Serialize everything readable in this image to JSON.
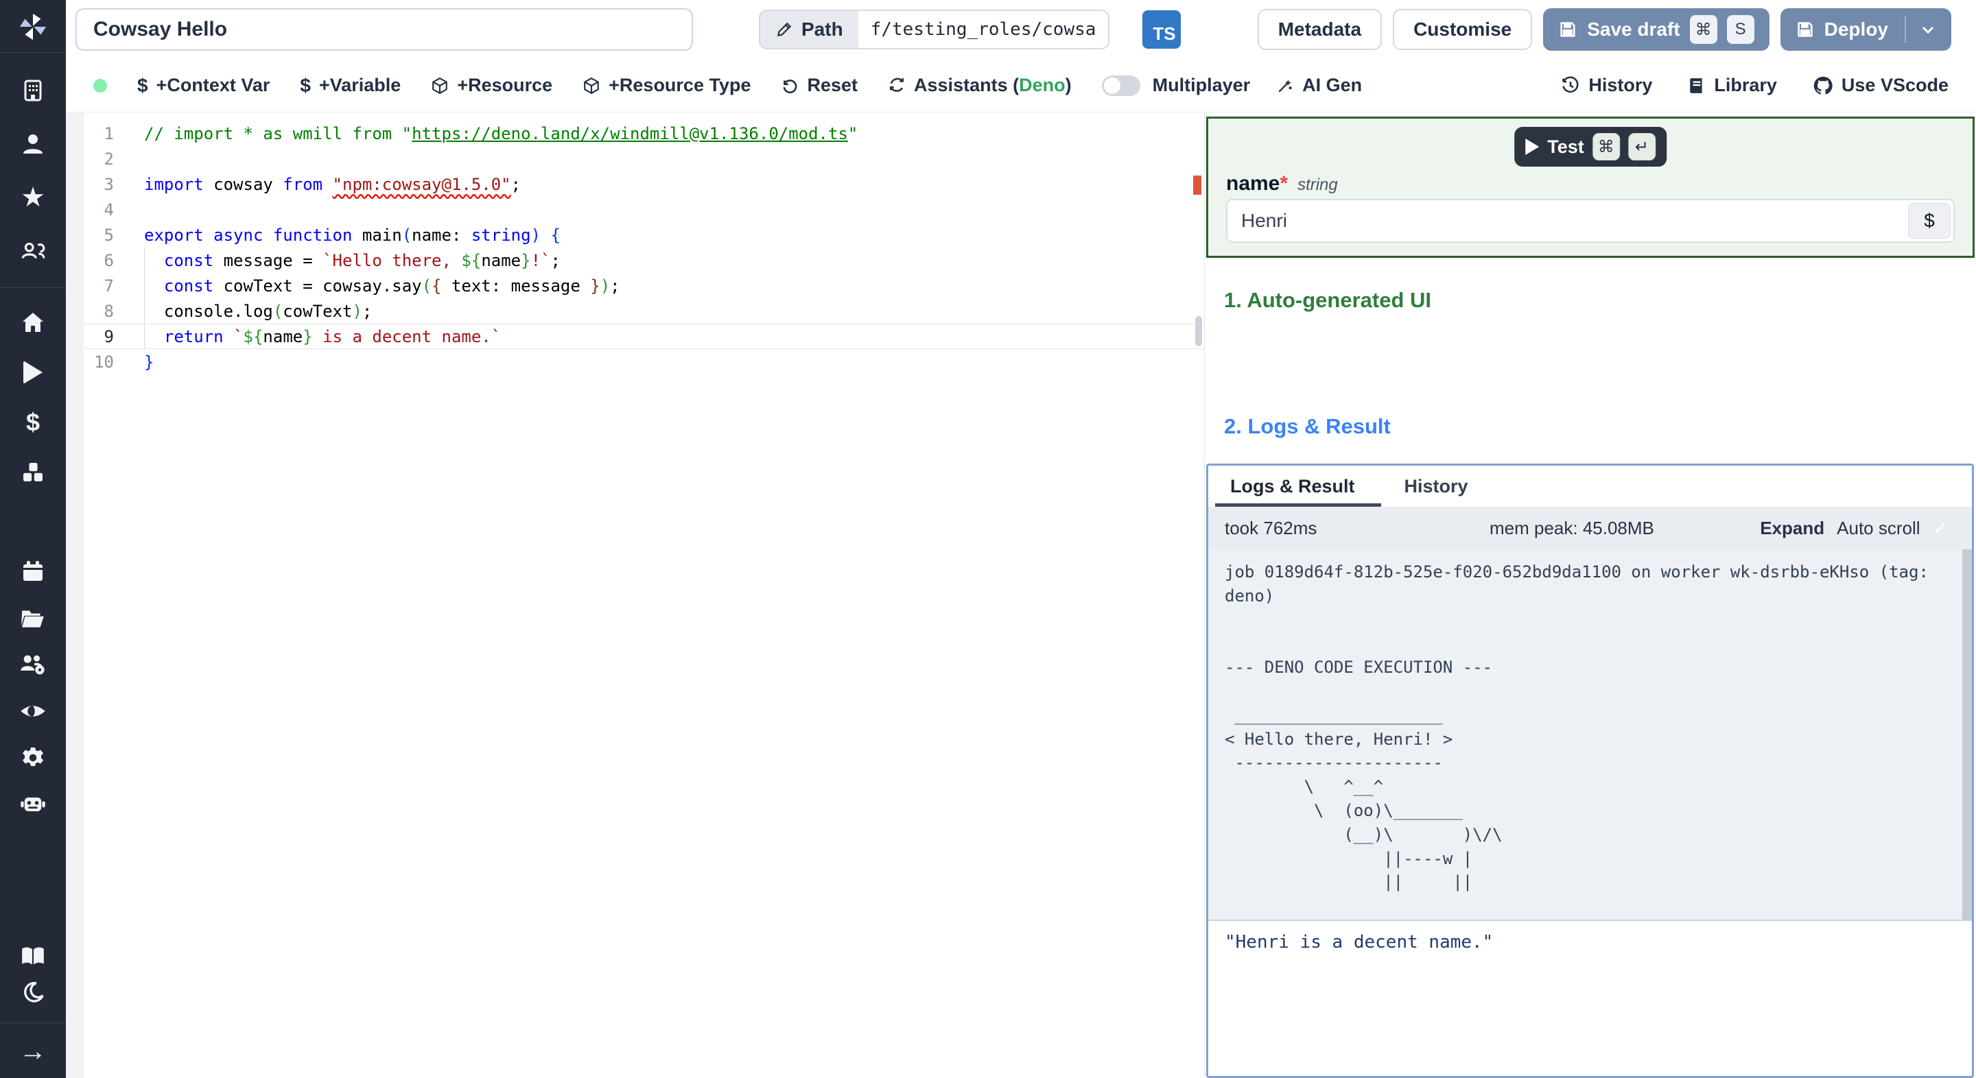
{
  "topbar": {
    "title_value": "Cowsay Hello",
    "path_label": "Path",
    "path_value": "f/testing_roles/cowsa",
    "ts_badge": "TS",
    "metadata_label": "Metadata",
    "customise_label": "Customise",
    "save_draft_label": "Save draft",
    "save_kbd1": "⌘",
    "save_kbd2": "S",
    "deploy_label": "Deploy"
  },
  "toolbar": {
    "context_var": "+Context Var",
    "variable": "+Variable",
    "resource": "+Resource",
    "resource_type": "+Resource Type",
    "reset": "Reset",
    "assistants_prefix": "Assistants (",
    "assistants_lang": "Deno",
    "assistants_suffix": ")",
    "multiplayer": "Multiplayer",
    "ai_gen": "AI Gen",
    "history": "History",
    "library": "Library",
    "use_vscode": "Use VScode",
    "dollar_icon": "$"
  },
  "sidebar": {
    "icons": [
      "windmill-logo",
      "building",
      "user",
      "star",
      "community",
      "home",
      "runs",
      "variables",
      "resources",
      "schedules",
      "folders",
      "groups",
      "audit-logs",
      "settings",
      "workers",
      "docs",
      "dark-mode",
      "collapse"
    ]
  },
  "editor": {
    "active_line": 9,
    "lines": [
      {
        "n": 1,
        "tokens": [
          [
            "c",
            "// import * as wmill from \""
          ],
          [
            "cl",
            "https://deno.land/x/windmill@v1.136.0/mod.ts"
          ],
          [
            "c",
            "\""
          ]
        ]
      },
      {
        "n": 2,
        "tokens": []
      },
      {
        "n": 3,
        "tokens": [
          [
            "k",
            "import"
          ],
          [
            "i",
            " cowsay "
          ],
          [
            "k",
            "from"
          ],
          [
            "i",
            " "
          ],
          [
            "sq",
            "\"npm:cowsay@1.5.0\""
          ],
          [
            "i",
            ";"
          ]
        ]
      },
      {
        "n": 4,
        "tokens": []
      },
      {
        "n": 5,
        "tokens": [
          [
            "k",
            "export"
          ],
          [
            "i",
            " "
          ],
          [
            "k",
            "async"
          ],
          [
            "i",
            " "
          ],
          [
            "k",
            "function"
          ],
          [
            "i",
            " main"
          ],
          [
            "b1",
            "("
          ],
          [
            "i",
            "name: "
          ],
          [
            "k",
            "string"
          ],
          [
            "b1",
            ")"
          ],
          [
            "i",
            " "
          ],
          [
            "b1",
            "{"
          ]
        ]
      },
      {
        "n": 6,
        "tokens": [
          [
            "i",
            "  "
          ],
          [
            "k",
            "const"
          ],
          [
            "i",
            " message = "
          ],
          [
            "s",
            "`Hello there, "
          ],
          [
            "b2",
            "${"
          ],
          [
            "i",
            "name"
          ],
          [
            "b2",
            "}"
          ],
          [
            "s",
            "!`"
          ],
          [
            "i",
            ";"
          ]
        ]
      },
      {
        "n": 7,
        "tokens": [
          [
            "i",
            "  "
          ],
          [
            "k",
            "const"
          ],
          [
            "i",
            " cowText = cowsay.say"
          ],
          [
            "b2",
            "("
          ],
          [
            "b3",
            "{"
          ],
          [
            "i",
            " text: message "
          ],
          [
            "b3",
            "}"
          ],
          [
            "b2",
            ")"
          ],
          [
            "i",
            ";"
          ]
        ]
      },
      {
        "n": 8,
        "tokens": [
          [
            "i",
            "  console.log"
          ],
          [
            "b2",
            "("
          ],
          [
            "i",
            "cowText"
          ],
          [
            "b2",
            ")"
          ],
          [
            "i",
            ";"
          ]
        ]
      },
      {
        "n": 9,
        "tokens": [
          [
            "i",
            "  "
          ],
          [
            "k",
            "return"
          ],
          [
            "i",
            " "
          ],
          [
            "s",
            "`"
          ],
          [
            "b2",
            "${"
          ],
          [
            "i",
            "name"
          ],
          [
            "b2",
            "}"
          ],
          [
            "s",
            " is a decent name.`"
          ]
        ]
      },
      {
        "n": 10,
        "tokens": [
          [
            "b1",
            "}"
          ]
        ]
      }
    ]
  },
  "panel": {
    "test_label": "Test",
    "test_kbd1": "⌘",
    "test_kbd2": "↵",
    "field_name": "name",
    "field_required": "*",
    "field_type": "string",
    "field_value": "Henri",
    "field_button": "$",
    "section1": "1. Auto-generated UI",
    "section2": "2. Logs & Result",
    "tab_logs": "Logs & Result",
    "tab_history": "History",
    "took": "took 762ms",
    "mem": "mem peak: 45.08MB",
    "expand": "Expand",
    "autoscroll": "Auto scroll",
    "check": "✓",
    "log_lines": [
      "job 0189d64f-812b-525e-f020-652bd9da1100 on worker wk-dsrbb-eKHso (tag: deno)",
      "",
      "",
      "--- DENO CODE EXECUTION ---",
      "",
      " _____________________",
      "< Hello there, Henri! >",
      " ---------------------",
      "        \\   ^__^",
      "         \\  (oo)\\_______",
      "            (__)\\       )\\/\\",
      "                ||----w |",
      "                ||     ||"
    ],
    "result": "\"Henri is a decent name.\""
  }
}
